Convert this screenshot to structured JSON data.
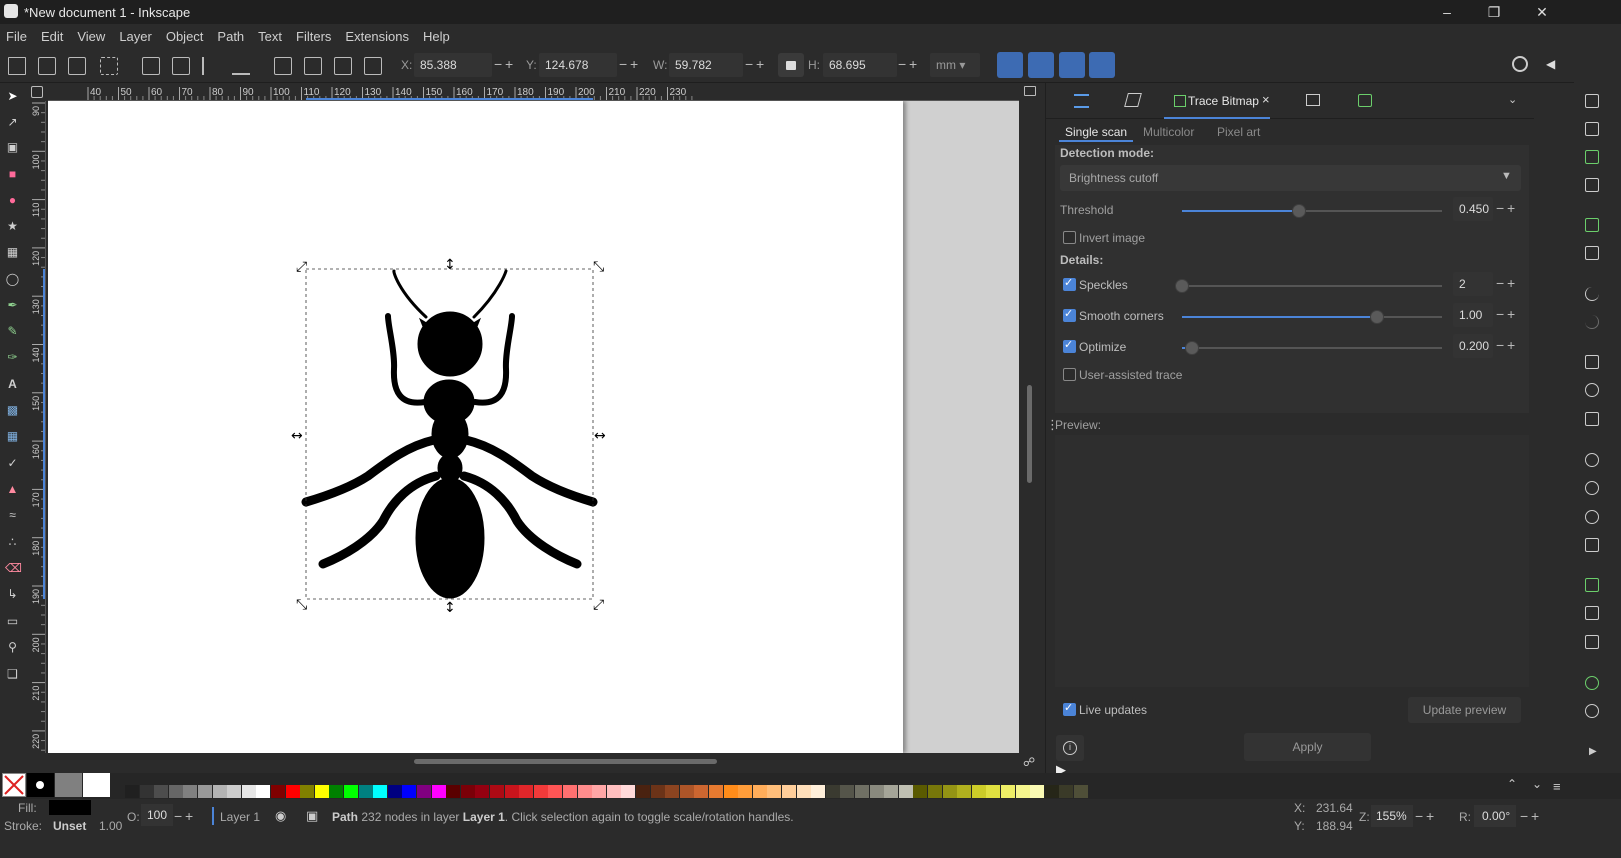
{
  "window": {
    "title": "*New document 1 - Inkscape"
  },
  "menu": [
    "File",
    "Edit",
    "View",
    "Layer",
    "Object",
    "Path",
    "Text",
    "Filters",
    "Extensions",
    "Help"
  ],
  "toolbar": {
    "x_label": "X:",
    "x_value": "85.388",
    "y_label": "Y:",
    "y_value": "124.678",
    "w_label": "W:",
    "w_value": "59.782",
    "h_label": "H:",
    "h_value": "68.695",
    "unit": "mm"
  },
  "ruler": {
    "h_ticks": [
      "40",
      "50",
      "60",
      "70",
      "80",
      "90",
      "100",
      "110",
      "120",
      "130",
      "140",
      "150",
      "160",
      "170",
      "180",
      "190",
      "200",
      "210",
      "220",
      "230"
    ],
    "v_ticks": [
      "90",
      "100",
      "110",
      "120",
      "130",
      "140",
      "150",
      "160",
      "170",
      "180",
      "190",
      "200",
      "210",
      "220"
    ]
  },
  "dialog": {
    "tab_label": "Trace Bitmap",
    "subtabs": [
      "Single scan",
      "Multicolor",
      "Pixel art"
    ],
    "detection_label": "Detection mode:",
    "detection_value": "Brightness cutoff",
    "threshold_label": "Threshold",
    "threshold_value": "0.450",
    "threshold_level": 0.45,
    "invert_label": "Invert image",
    "invert_checked": false,
    "details_label": "Details:",
    "speckles_label": "Speckles",
    "speckles_value": "2",
    "speckles_checked": true,
    "speckles_level": 0.0,
    "smooth_label": "Smooth corners",
    "smooth_value": "1.00",
    "smooth_checked": true,
    "smooth_level": 0.75,
    "optimize_label": "Optimize",
    "optimize_value": "0.200",
    "optimize_checked": true,
    "optimize_level": 0.04,
    "user_assisted_label": "User-assisted trace",
    "user_assisted_checked": false,
    "preview_label": "Preview:",
    "live_updates_label": "Live updates",
    "live_updates_checked": true,
    "update_preview_label": "Update preview",
    "apply_label": "Apply"
  },
  "status": {
    "fill_label": "Fill:",
    "stroke_label": "Stroke:",
    "stroke_value": "Unset",
    "stroke_width": "1.00",
    "opacity_label": "O:",
    "opacity_value": "100",
    "layer_name": "Layer 1",
    "message_prefix": "Path",
    "message_middle": " 232 nodes in layer ",
    "message_layer": "Layer 1",
    "message_suffix": ". Click selection again to toggle scale/rotation handles.",
    "cursor_x_label": "X:",
    "cursor_x": "231.64",
    "cursor_y_label": "Y:",
    "cursor_y": "188.94",
    "zoom_label": "Z:",
    "zoom": "155%",
    "rotate_label": "R:",
    "rotate": "0.00°"
  },
  "colors": {
    "accent": "#4b84d8",
    "bg": "#2b2b2b"
  },
  "palette": [
    "#202020",
    "#333333",
    "#4d4d4d",
    "#666666",
    "#808080",
    "#999999",
    "#b3b3b3",
    "#cccccc",
    "#e6e6e6",
    "#ffffff",
    "#800000",
    "#ff0000",
    "#808000",
    "#ffff00",
    "#008000",
    "#00ff00",
    "#008080",
    "#00ffff",
    "#000080",
    "#0000ff",
    "#800080",
    "#ff00ff",
    "#5a0000",
    "#7a0008",
    "#940010",
    "#ad0a14",
    "#c8141c",
    "#e0262a",
    "#f23a3a",
    "#ff5555",
    "#ff7070",
    "#ff8c8c",
    "#ffa6a6",
    "#ffbfbf",
    "#ffd9d9",
    "#4a2210",
    "#6b3318",
    "#8c4420",
    "#ad5528",
    "#cc6630",
    "#e67a30",
    "#ff8c1a",
    "#ff9d3a",
    "#ffad5a",
    "#ffbe7a",
    "#ffce9a",
    "#ffdfba",
    "#ffefda",
    "#3a3a30",
    "#55554a",
    "#707064",
    "#8a8a7e",
    "#a5a598",
    "#c0c0b2",
    "#5a5a00",
    "#77770a",
    "#949414",
    "#b0b01e",
    "#cccc28",
    "#e0e040",
    "#eeee66",
    "#f5f58c",
    "#fafab3",
    "#262618",
    "#3a3a28",
    "#4f4f38"
  ]
}
